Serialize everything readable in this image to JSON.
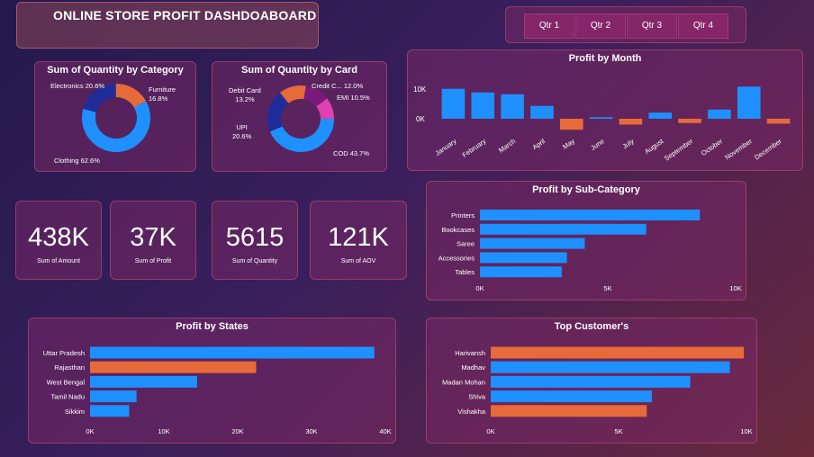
{
  "header": {
    "title": "ONLINE STORE PROFIT  DASHDOABOARD"
  },
  "slicer": {
    "quarters": [
      "Qtr 1",
      "Qtr 2",
      "Qtr 3",
      "Qtr 4"
    ]
  },
  "colors": {
    "blue": "#1e90ff",
    "orange": "#e66a3a",
    "navy": "#1f2c9a",
    "purple": "#7a1a7a",
    "pink": "#e040b0"
  },
  "kpis": [
    {
      "value": "438K",
      "label": "Sum of Amount"
    },
    {
      "value": "37K",
      "label": "Sum of Profit"
    },
    {
      "value": "5615",
      "label": "Sum of Quantity"
    },
    {
      "value": "121K",
      "label": "Sum of AOV"
    }
  ],
  "chart_data": [
    {
      "type": "pie",
      "title": "Sum of Quantity by Category",
      "slices": [
        {
          "name": "Clothing",
          "percent": 62.6,
          "label": "Clothing 62.6%",
          "color": "#1e90ff"
        },
        {
          "name": "Electronics",
          "percent": 20.6,
          "label": "Electronics\n20.6%",
          "color": "#1f2c9a"
        },
        {
          "name": "Furniture",
          "percent": 16.8,
          "label": "Furniture\n16.8%",
          "color": "#e66a3a"
        }
      ]
    },
    {
      "type": "pie",
      "title": "Sum of Quantity by Card",
      "slices": [
        {
          "name": "COD",
          "percent": 43.7,
          "label": "COD 43.7%",
          "color": "#1e90ff"
        },
        {
          "name": "UPI",
          "percent": 20.6,
          "label": "UPI\n20.6%",
          "color": "#1f2c9a"
        },
        {
          "name": "Debit Card",
          "percent": 13.2,
          "label": "Debit Card\n13.2%",
          "color": "#e66a3a"
        },
        {
          "name": "Credit C...",
          "percent": 12.0,
          "label": "Credit C... 12.0%",
          "color": "#7a1a7a"
        },
        {
          "name": "EMI",
          "percent": 10.5,
          "label": "EMI 10.5%",
          "color": "#e040b0"
        }
      ]
    },
    {
      "type": "bar",
      "title": "Profit by Month",
      "categories": [
        "January",
        "February",
        "March",
        "April",
        "May",
        "June",
        "July",
        "August",
        "September",
        "October",
        "November",
        "December"
      ],
      "values": [
        9800,
        8600,
        8000,
        4200,
        -3600,
        500,
        -1900,
        2000,
        -1400,
        3000,
        10500,
        -1600
      ],
      "yticks": [
        "10K",
        "0K"
      ],
      "ylim": [
        -5000,
        12000
      ]
    },
    {
      "type": "bar",
      "orientation": "horizontal",
      "title": "Profit by Sub-Category",
      "categories": [
        "Printers",
        "Bookcases",
        "Saree",
        "Accessories",
        "Tables"
      ],
      "values": [
        8600,
        6500,
        4100,
        3400,
        3200
      ],
      "xticks": [
        "0K",
        "5K",
        "10K"
      ],
      "xlim": [
        0,
        10000
      ]
    },
    {
      "type": "bar",
      "orientation": "horizontal",
      "title": "Profit by States",
      "categories": [
        "Uttar Pradesh",
        "Rajasthan",
        "West Bengal",
        "Tamil Nadu",
        "Sikkim"
      ],
      "values": [
        38500,
        22500,
        14500,
        6300,
        5300
      ],
      "highlight": [
        false,
        true,
        false,
        false,
        false
      ],
      "xticks": [
        "0K",
        "10K",
        "20K",
        "30K",
        "40K"
      ],
      "xlim": [
        0,
        40000
      ]
    },
    {
      "type": "bar",
      "orientation": "horizontal",
      "title": "Top Customer's",
      "categories": [
        "Harivansh",
        "Madhav",
        "Madan Mohan",
        "Shiva",
        "Vishakha"
      ],
      "values": [
        9900,
        9350,
        7800,
        6300,
        6100
      ],
      "highlight": [
        true,
        false,
        false,
        false,
        true
      ],
      "xticks": [
        "0K",
        "5K",
        "10K"
      ],
      "xlim": [
        0,
        10000
      ]
    }
  ]
}
